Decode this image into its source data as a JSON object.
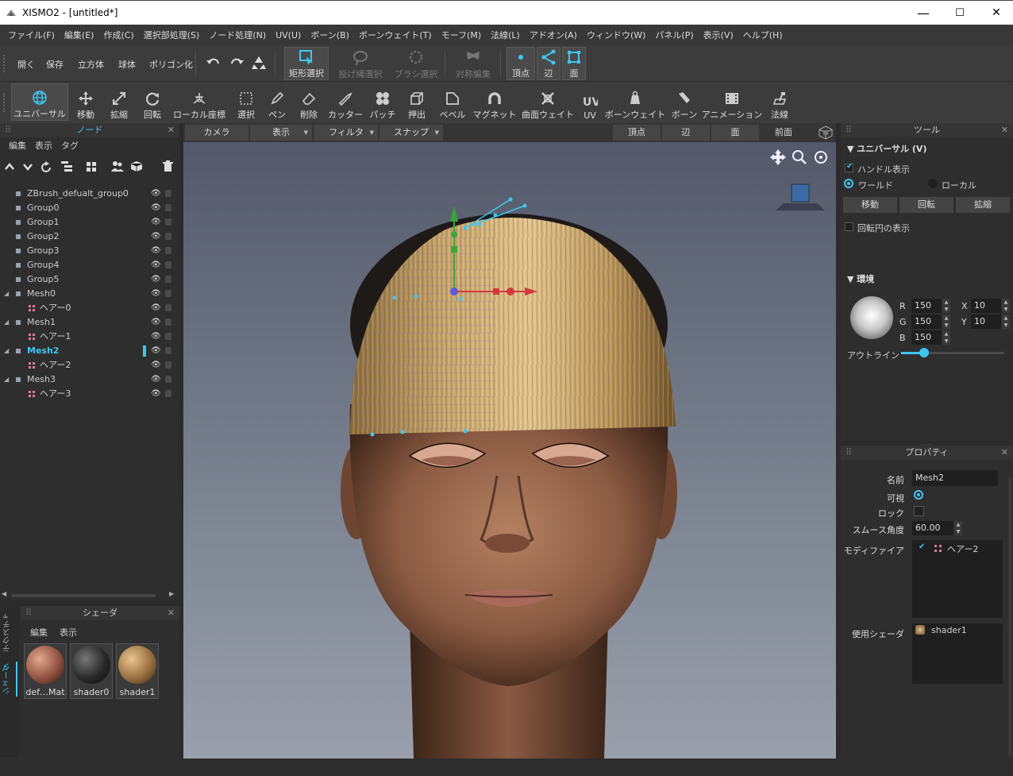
{
  "window": {
    "title": "XISMO2 - [untitled*]",
    "min": "—",
    "max": "☐",
    "close": "✕"
  },
  "menu": [
    "ファイル(F)",
    "編集(E)",
    "作成(C)",
    "選択部処理(S)",
    "ノード処理(N)",
    "UV(U)",
    "ボーン(B)",
    "ボーンウェイト(T)",
    "モーフ(M)",
    "法線(L)",
    "アドオン(A)",
    "ウィンドウ(W)",
    "パネル(P)",
    "表示(V)",
    "ヘルプ(H)"
  ],
  "toolbar1": {
    "open": "開く",
    "save": "保存",
    "cube": "立方体",
    "sphere": "球体",
    "polygon": "ポリゴン化",
    "rect_select": "矩形選択",
    "lasso_select": "投げ縄選択",
    "brush_select": "ブラシ選択",
    "sym_edit": "対称編集",
    "vertex": "頂点",
    "edge": "辺",
    "face": "面"
  },
  "toolbar2": [
    "ユニバーサル",
    "移動",
    "拡縮",
    "回転",
    "ローカル座標",
    "選択",
    "ペン",
    "削除",
    "カッター",
    "パッチ",
    "押出",
    "ベベル",
    "マグネット",
    "曲面ウェイト",
    "UV",
    "ボーンウェイト",
    "ボーン",
    "アニメーション",
    "法線"
  ],
  "node_panel": {
    "title": "ノード",
    "menu": [
      "編集",
      "表示",
      "タグ"
    ],
    "items": [
      {
        "name": "ZBrush_defualt_group0",
        "depth": 0,
        "type": "group"
      },
      {
        "name": "Group0",
        "depth": 0,
        "type": "group"
      },
      {
        "name": "Group1",
        "depth": 0,
        "type": "group"
      },
      {
        "name": "Group2",
        "depth": 0,
        "type": "group"
      },
      {
        "name": "Group3",
        "depth": 0,
        "type": "group"
      },
      {
        "name": "Group4",
        "depth": 0,
        "type": "group"
      },
      {
        "name": "Group5",
        "depth": 0,
        "type": "group"
      },
      {
        "name": "Mesh0",
        "depth": 0,
        "type": "mesh"
      },
      {
        "name": "ヘアー0",
        "depth": 1,
        "type": "modifier"
      },
      {
        "name": "Mesh1",
        "depth": 0,
        "type": "mesh"
      },
      {
        "name": "ヘアー1",
        "depth": 1,
        "type": "modifier"
      },
      {
        "name": "Mesh2",
        "depth": 0,
        "type": "mesh",
        "selected": true
      },
      {
        "name": "ヘアー2",
        "depth": 1,
        "type": "modifier"
      },
      {
        "name": "Mesh3",
        "depth": 0,
        "type": "mesh"
      },
      {
        "name": "ヘアー3",
        "depth": 1,
        "type": "modifier"
      }
    ]
  },
  "shader_panel": {
    "title": "シェーダ",
    "menu": [
      "編集",
      "表示"
    ],
    "side_tabs": [
      "テクスチャ",
      "シェーダ"
    ],
    "items": [
      "def…Mat",
      "shader0",
      "shader1"
    ]
  },
  "viewport": {
    "bar": {
      "camera": "カメラ",
      "display": "表示",
      "filter": "フィルタ",
      "snap": "スナップ",
      "vertex": "頂点",
      "edge": "辺",
      "face": "面",
      "view": "前面"
    }
  },
  "tool_panel": {
    "title": "ツール",
    "section": "ユニバーサル (V)",
    "handle_display": "ハンドル表示",
    "world": "ワールド",
    "local": "ローカル",
    "move": "移動",
    "rotate": "回転",
    "scale": "拡縮",
    "rot_circle": "回転円の表示",
    "env_section": "環境",
    "r_label": "R",
    "g_label": "G",
    "b_label": "B",
    "r": "150",
    "g": "150",
    "b": "150",
    "x_label": "X",
    "y_label": "Y",
    "x": "10",
    "y": "10",
    "outline": "アウトライン",
    "outline_level": 0.22
  },
  "props": {
    "title": "プロパティ",
    "name_label": "名前",
    "name": "Mesh2",
    "visible_label": "可視",
    "lock_label": "ロック",
    "smooth_label": "スムース角度",
    "smooth": "60.00",
    "modifier_label": "モディファイア",
    "modifier": "ヘアー2",
    "shader_label": "使用シェーダ",
    "shader": "shader1"
  }
}
